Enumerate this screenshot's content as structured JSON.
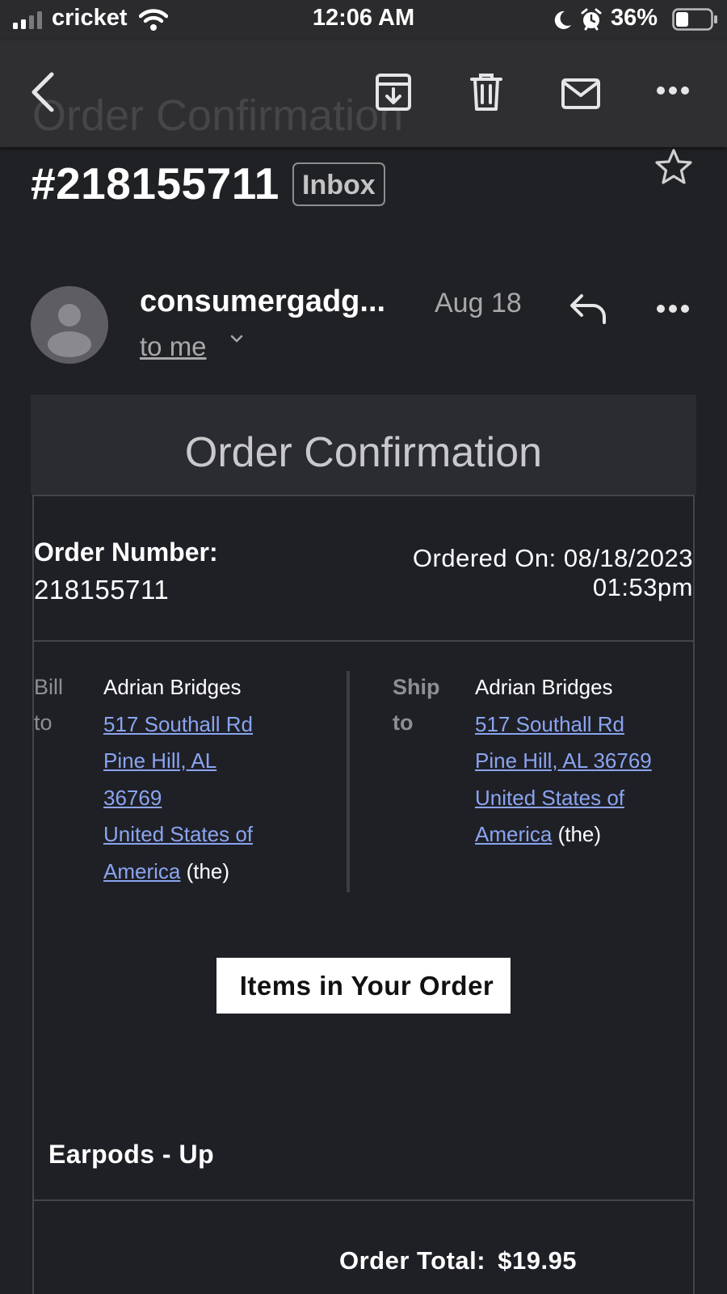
{
  "status_bar": {
    "carrier": "cricket",
    "time": "12:06 AM",
    "battery": "36%"
  },
  "toolbar": {
    "ghost_subject": "Order Confirmation"
  },
  "email": {
    "subject": "#218155711",
    "label": "Inbox",
    "sender": "consumergadg...",
    "date": "Aug 18",
    "recipient": "to me"
  },
  "body": {
    "title": "Order Confirmation",
    "order_number_label": "Order Number:",
    "order_number": "218155711",
    "ordered_on_line1": "Ordered On: 08/18/2023",
    "ordered_on_line2": "01:53pm",
    "bill_to": {
      "label_line1": "Bill",
      "label_line2": "to",
      "name": "Adrian Bridges",
      "street": "517 Southall Rd",
      "city_state": "Pine Hill, AL",
      "zip": "36769",
      "country_line1": "United States of",
      "country_line2": "America",
      "country_suffix": "(the)"
    },
    "ship_to": {
      "label_line1": "Ship",
      "label_line2": "to",
      "name": "Adrian Bridges",
      "street": "517 Southall Rd",
      "city_state_zip": "Pine Hill, AL 36769",
      "country_line1": "United States of",
      "country_line2": "America",
      "country_suffix": "(the)"
    },
    "items_heading": "Items in Your Order",
    "item_name": "Earpods - Up",
    "total_label": "Order Total:",
    "total_value": "$19.95"
  },
  "icons": {
    "signal": "signal-bars-icon",
    "wifi": "wifi-icon",
    "moon": "moon-icon",
    "alarm": "alarm-icon",
    "battery": "battery-icon",
    "back": "back-chevron-icon",
    "archive": "archive-icon",
    "delete": "trash-icon",
    "mark_unread": "mail-icon",
    "more": "more-horizontal-icon",
    "star": "star-icon",
    "reply": "reply-icon",
    "avatar": "person-icon"
  },
  "colors": {
    "background": "#202125",
    "link": "#8aa4f0",
    "toolbar": "#2f2f32"
  }
}
